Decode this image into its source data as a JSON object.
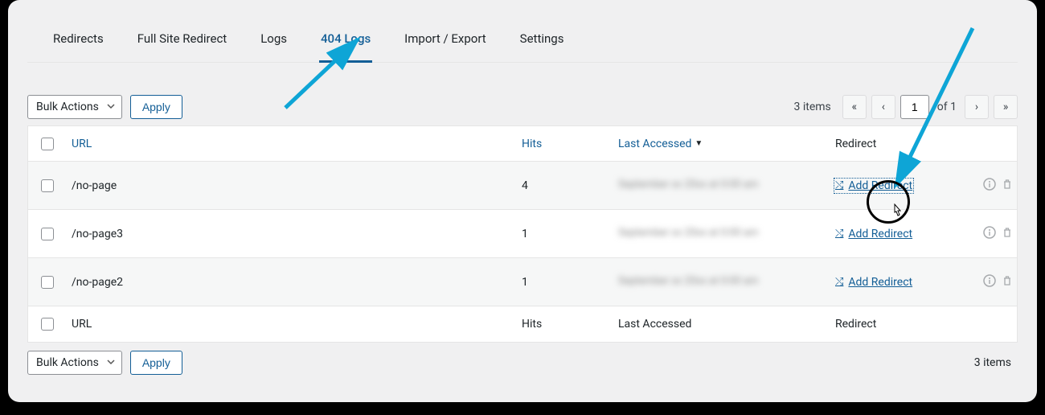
{
  "tabs": {
    "redirects": "Redirects",
    "full_site": "Full Site Redirect",
    "logs": "Logs",
    "logs_404": "404 Logs",
    "import_export": "Import / Export",
    "settings": "Settings"
  },
  "bulk": {
    "label": "Bulk Actions",
    "apply": "Apply"
  },
  "items_label": "3 items",
  "page_input": "1",
  "of_text": "of 1",
  "columns": {
    "url": "URL",
    "hits": "Hits",
    "last_accessed": "Last Accessed",
    "redirect": "Redirect"
  },
  "rows": [
    {
      "url": "/no-page",
      "hits": "4",
      "date": "September xx 20xx at 0:00 am",
      "action": "Add Redirect"
    },
    {
      "url": "/no-page3",
      "hits": "1",
      "date": "September xx 20xx at 0:00 am",
      "action": "Add Redirect"
    },
    {
      "url": "/no-page2",
      "hits": "1",
      "date": "September xx 20xx at 0:00 am",
      "action": "Add Redirect"
    }
  ],
  "footer": {
    "url": "URL",
    "hits": "Hits",
    "last_accessed": "Last Accessed",
    "redirect": "Redirect"
  }
}
